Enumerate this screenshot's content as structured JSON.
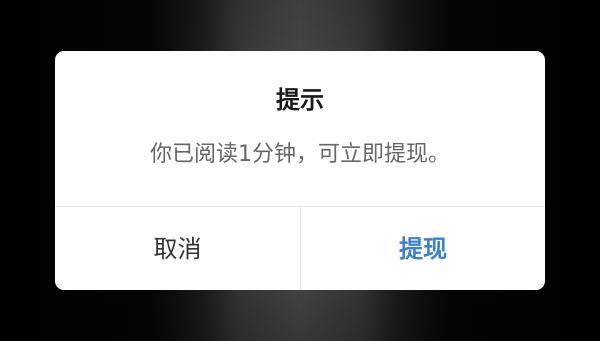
{
  "dialog": {
    "title": "提示",
    "message": "你已阅读1分钟，可立即提现。",
    "cancel_label": "取消",
    "confirm_label": "提现"
  },
  "colors": {
    "confirm_accent": "#3a7fd5",
    "cancel_text": "#333333",
    "message_text": "#666666",
    "title_text": "#1a1a1a",
    "dialog_background": "#ffffff"
  }
}
